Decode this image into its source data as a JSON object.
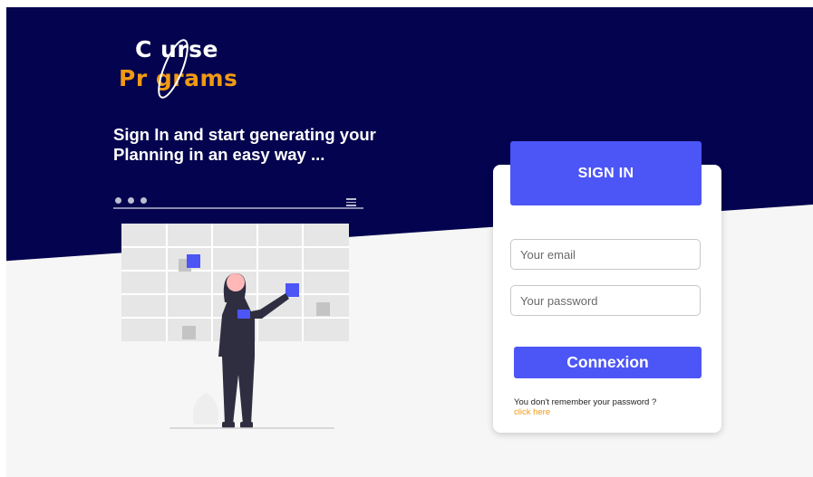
{
  "brand": {
    "logo_line1": "C  urse",
    "logo_line2": "Pr  grams",
    "primary_color": "#03034f",
    "accent_color": "#4c55f5",
    "orange": "#f19a14"
  },
  "hero": {
    "tagline_line1": "Sign In and start generating your",
    "tagline_line2": "Planning in an easy way ..."
  },
  "login": {
    "header": "SIGN IN",
    "email_placeholder": "Your email",
    "password_placeholder": "Your password",
    "submit_label": "Connexion",
    "forgot_text": "You don't remember your password ?",
    "forgot_link": "click here"
  }
}
